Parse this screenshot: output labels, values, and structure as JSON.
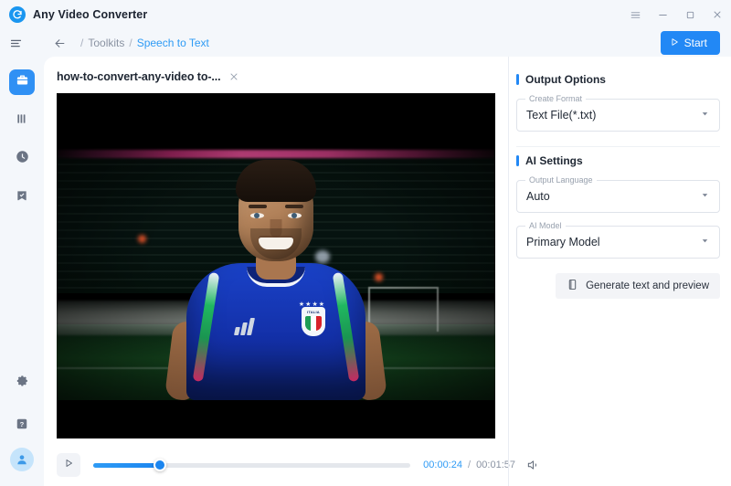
{
  "window": {
    "app_title": "Any Video Converter",
    "logo_icon": "convert-circle-icon",
    "controls": {
      "menu_label": "☰",
      "minimize_label": "–",
      "maximize_label": "□",
      "close_label": "×"
    }
  },
  "toolbar": {
    "menu_icon": "hamburger-list-icon",
    "back_icon": "arrow-left-icon",
    "breadcrumb": {
      "separator": "/",
      "parent": "Toolkits",
      "current": "Speech to Text"
    },
    "start_label": "Start",
    "start_icon": "play-triangle-icon",
    "start_color": "#2288f5"
  },
  "sidebar": {
    "items": [
      {
        "name": "toolkits",
        "icon": "toolbox-icon",
        "active": true
      },
      {
        "name": "library",
        "icon": "library-icon",
        "active": false
      },
      {
        "name": "history",
        "icon": "clock-icon",
        "active": false
      },
      {
        "name": "tasks",
        "icon": "checklist-icon",
        "active": false
      }
    ],
    "bottom_items": [
      {
        "name": "settings",
        "icon": "gear-icon"
      },
      {
        "name": "help",
        "icon": "question-mark-icon"
      },
      {
        "name": "account",
        "icon": "user-avatar-icon"
      }
    ]
  },
  "main": {
    "video_tab": {
      "title": "how-to-convert-any-video to-...",
      "close_icon": "close-icon"
    },
    "player": {
      "play_icon": "play-triangle-icon",
      "volume_icon": "speaker-icon",
      "current_time": "00:00:24",
      "time_separator": "/",
      "duration": "00:01:57",
      "progress_percent": 21,
      "current_time_color": "#2e9bf5"
    }
  },
  "panel": {
    "output_options": {
      "heading": "Output Options",
      "create_format": {
        "label": "Create Format",
        "value": "Text File(*.txt)",
        "caret_icon": "chevron-down-icon"
      }
    },
    "ai_settings": {
      "heading": "AI Settings",
      "output_language": {
        "label": "Output Language",
        "value": "Auto",
        "caret_icon": "chevron-down-icon"
      },
      "ai_model": {
        "label": "AI Model",
        "value": "Primary Model",
        "caret_icon": "chevron-down-icon"
      }
    },
    "generate_button": {
      "label": "Generate text and preview",
      "icon": "document-icon"
    }
  },
  "video_frame": {
    "description": "Soccer player in blue Italy national team jersey smiling on a dark night pitch",
    "crest_text": "ITALIA",
    "stars": "★★★★"
  }
}
